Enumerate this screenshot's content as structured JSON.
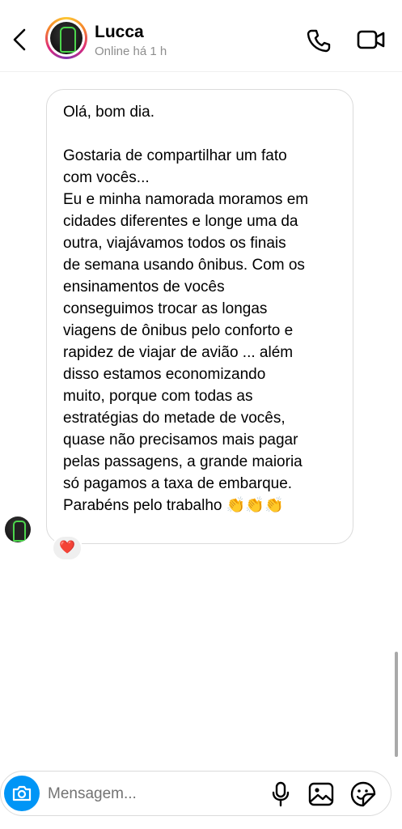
{
  "header": {
    "contact_name": "Lucca",
    "status": "Online há 1 h",
    "icons": [
      "back-chevron-icon",
      "phone-icon",
      "video-camera-icon"
    ]
  },
  "conversation": {
    "message_text": "Olá, bom dia.\n\nGostaria de compartilhar um fato\ncom vocês...\nEu e minha namorada moramos em\ncidades diferentes e longe uma da\noutra, viajávamos todos os finais\nde semana usando ônibus. Com os\nensinamentos de vocês\nconseguimos trocar as longas\nviagens de ônibus pelo conforto e\nrapidez de viajar de avião ... além\ndisso estamos economizando\nmuito, porque com todas as\nestratégias do metade de vocês,\nquase não precisamos mais pagar\npelas passagens, a grande maioria\nsó pagamos a taxa de embarque.\nParabéns pelo trabalho 👏👏👏",
    "reaction": "❤️"
  },
  "composer": {
    "placeholder": "Mensagem...",
    "icons": [
      "camera-icon",
      "microphone-icon",
      "gallery-icon",
      "sticker-icon"
    ],
    "accent_color": "#0095f6"
  }
}
